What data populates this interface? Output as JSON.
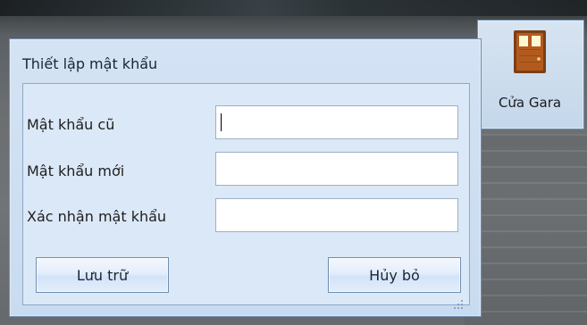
{
  "dialog": {
    "title": "Thiết lập mật khẩu",
    "fields": [
      {
        "label": "Mật khẩu cũ",
        "value": "",
        "placeholder": ""
      },
      {
        "label": "Mật khẩu mới",
        "value": "",
        "placeholder": ""
      },
      {
        "label": "Xác nhận mật khẩu",
        "value": "",
        "placeholder": ""
      }
    ],
    "buttons": {
      "save_label": "Lưu trữ",
      "cancel_label": "Hủy bỏ"
    }
  },
  "tile": {
    "label": "Cửa Gara",
    "icon": "door-icon"
  },
  "colors": {
    "dialog_bg": "#d4e3f4",
    "panel_bg": "#dbe8f7",
    "border": "#6f8fb1",
    "input_bg": "#ffffff",
    "button_top": "#f4f8fd",
    "button_bottom": "#d2e3f8",
    "door": "#b45a1e"
  }
}
